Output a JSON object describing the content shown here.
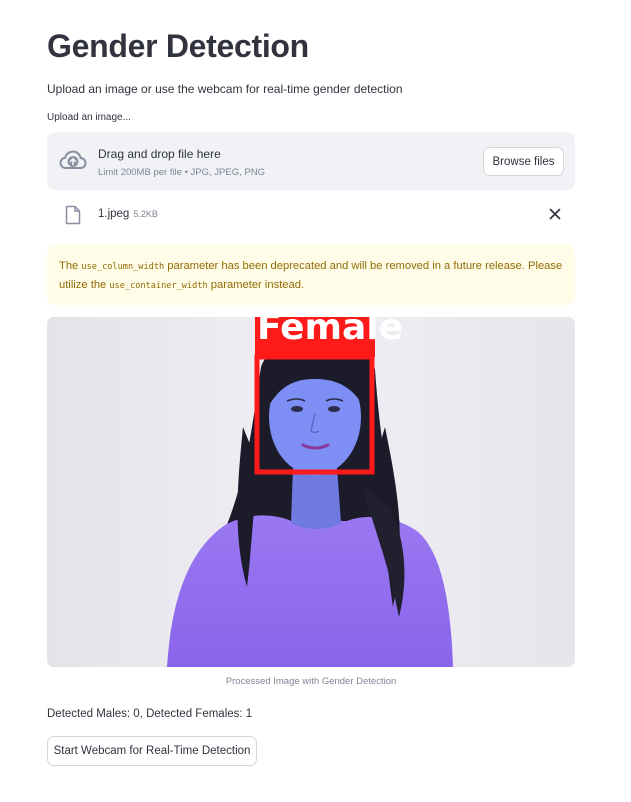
{
  "page": {
    "title": "Gender Detection",
    "subtitle": "Upload an image or use the webcam for real-time gender detection"
  },
  "uploader": {
    "label": "Upload an image...",
    "drop_title": "Drag and drop file here",
    "limit_text": "Limit 200MB per file • JPG, JPEG, PNG",
    "browse_label": "Browse files",
    "icon": "cloud-upload-icon"
  },
  "file": {
    "name": "1.jpeg",
    "size": "5.2KB",
    "icon": "file-icon"
  },
  "warning": {
    "part1": "The ",
    "code1": "use_column_width",
    "part2": " parameter has been deprecated and will be removed in a future release. Please utilize the ",
    "code2": "use_container_width",
    "part3": " parameter instead."
  },
  "image": {
    "detection_label": "Female",
    "caption": "Processed Image with Gender Detection"
  },
  "results": {
    "counts_text": "Detected Males: 0, Detected Females: 1"
  },
  "actions": {
    "webcam_label": "Start Webcam for Real-Time Detection"
  },
  "colors": {
    "text": "#31333f",
    "muted": "#808495",
    "dropzone_bg": "#f0f2f6",
    "warning_bg": "#fffce7",
    "warning_text": "#926c05",
    "box_red": "#ff1a1a"
  }
}
